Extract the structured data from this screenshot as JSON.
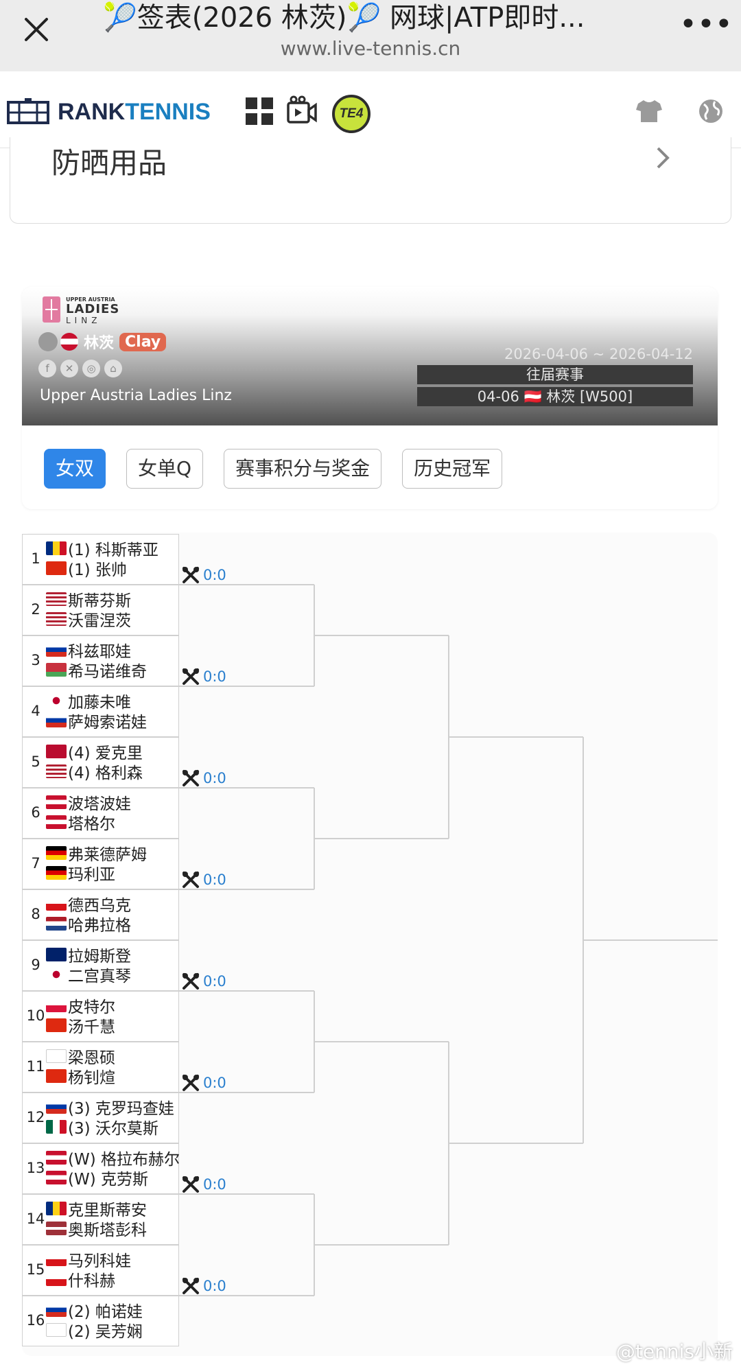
{
  "browser": {
    "title": "🎾签表(2026 林茨)🎾 网球|ATP即时...",
    "url": "www.live-tennis.cn"
  },
  "site": {
    "logo_rank": "RANK",
    "logo_tennis": "TENNIS",
    "badge": "TE4"
  },
  "prev_card": {
    "text": "防晒用品"
  },
  "tournament": {
    "logo_small": "UPPER AUSTRIA",
    "logo_main": "LADIES",
    "logo_sub": "LINZ",
    "city": "林茨",
    "surface": "Clay",
    "name": "Upper Austria Ladies Linz",
    "dates": "2026-04-06 ~ 2026-04-12",
    "past_label": "往届赛事",
    "edition_label": "04-06 🇦🇹 林茨 [W500]",
    "accent": "#2f86e8",
    "surface_color": "#e0684f"
  },
  "tabs": [
    {
      "label": "女双",
      "active": true
    },
    {
      "label": "女单Q",
      "active": false
    },
    {
      "label": "赛事积分与奖金",
      "active": false
    },
    {
      "label": "历史冠军",
      "active": false
    }
  ],
  "draw": {
    "entries": [
      {
        "no": "1",
        "players": [
          {
            "flag": "ro",
            "name": "(1) 科斯蒂亚"
          },
          {
            "flag": "cn",
            "name": "(1) 张帅"
          }
        ]
      },
      {
        "no": "2",
        "players": [
          {
            "flag": "us",
            "name": "斯蒂芬斯"
          },
          {
            "flag": "us",
            "name": "沃雷涅茨"
          }
        ]
      },
      {
        "no": "3",
        "players": [
          {
            "flag": "ru",
            "name": "科兹耶娃"
          },
          {
            "flag": "by",
            "name": "希马诺维奇"
          }
        ]
      },
      {
        "no": "4",
        "players": [
          {
            "flag": "jp",
            "name": "加藤未唯"
          },
          {
            "flag": "ru",
            "name": "萨姆索诺娃"
          }
        ]
      },
      {
        "no": "5",
        "players": [
          {
            "flag": "no",
            "name": "(4) 爱克里"
          },
          {
            "flag": "us",
            "name": "(4) 格利森"
          }
        ]
      },
      {
        "no": "6",
        "players": [
          {
            "flag": "at",
            "name": "波塔波娃"
          },
          {
            "flag": "at",
            "name": "塔格尔"
          }
        ]
      },
      {
        "no": "7",
        "players": [
          {
            "flag": "de",
            "name": "弗莱德萨姆"
          },
          {
            "flag": "de",
            "name": "玛利亚"
          }
        ]
      },
      {
        "no": "8",
        "players": [
          {
            "flag": "cz",
            "name": "德西乌克"
          },
          {
            "flag": "nl",
            "name": "哈弗拉格"
          }
        ]
      },
      {
        "no": "9",
        "players": [
          {
            "flag": "gb",
            "name": "拉姆斯登"
          },
          {
            "flag": "jp",
            "name": "二宫真琴"
          }
        ]
      },
      {
        "no": "10",
        "players": [
          {
            "flag": "pl",
            "name": "皮特尔"
          },
          {
            "flag": "cn",
            "name": "汤千慧"
          }
        ]
      },
      {
        "no": "11",
        "players": [
          {
            "flag": "tpe",
            "name": "梁恩硕"
          },
          {
            "flag": "cn",
            "name": "杨钊煊"
          }
        ]
      },
      {
        "no": "12",
        "players": [
          {
            "flag": "ru",
            "name": "(3) 克罗玛查娃"
          },
          {
            "flag": "mx",
            "name": "(3) 沃尔莫斯"
          }
        ]
      },
      {
        "no": "13",
        "players": [
          {
            "flag": "at",
            "name": "(W) 格拉布赫尔"
          },
          {
            "flag": "at",
            "name": "(W) 克劳斯"
          }
        ]
      },
      {
        "no": "14",
        "players": [
          {
            "flag": "ro",
            "name": "克里斯蒂安"
          },
          {
            "flag": "lv",
            "name": "奥斯塔彭科"
          }
        ]
      },
      {
        "no": "15",
        "players": [
          {
            "flag": "cz",
            "name": "马列科娃"
          },
          {
            "flag": "cz",
            "name": "什科赫"
          }
        ]
      },
      {
        "no": "16",
        "players": [
          {
            "flag": "ru",
            "name": "(2) 帕诺娃"
          },
          {
            "flag": "tpe",
            "name": "(2) 吴芳娴"
          }
        ]
      }
    ],
    "scores": [
      "0:0",
      "0:0",
      "0:0",
      "0:0",
      "0:0",
      "0:0",
      "0:0",
      "0:0"
    ],
    "score_color": "#2a7fce",
    "line_color": "#cfcfcf"
  },
  "watermark": "@tennis小新"
}
